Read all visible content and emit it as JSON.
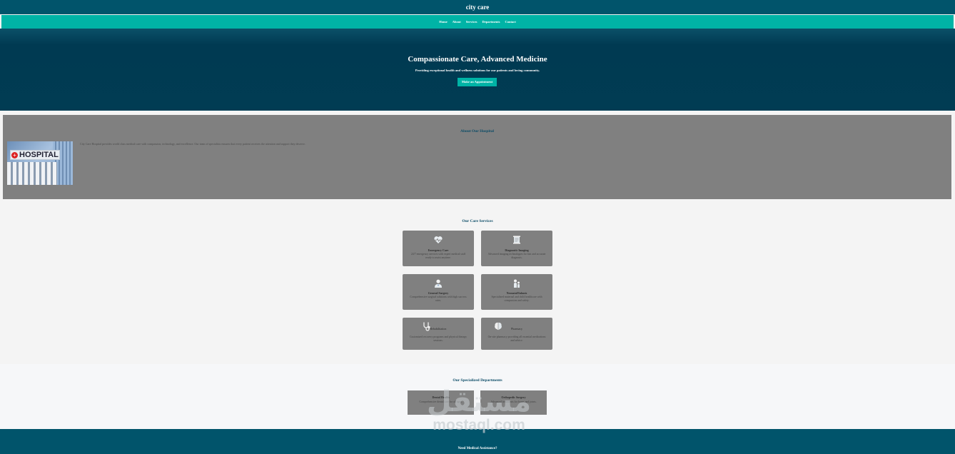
{
  "header": {
    "title": "city care"
  },
  "nav": {
    "items": [
      "Home",
      "About",
      "Services",
      "Departments",
      "Contact"
    ]
  },
  "hero": {
    "title": "Compassionate Care, Advanced Medicine",
    "subtitle": "Providing exceptional health and wellness solutions for our patients and loving community.",
    "cta": "Make an Appointment"
  },
  "about": {
    "heading": "About Our Hospital",
    "text": "City Care Hospital provides world class medical care with compassion, technology, and excellence. Our team of specialists ensures that every patient receives the attention and support they deserve.",
    "image_sign": "HOSPITAL"
  },
  "services": {
    "heading": "Our Care Services",
    "items": [
      {
        "icon": "heart-pulse-icon",
        "title": "Emergency Care",
        "desc": "24/7 emergency services with expert medical staff ready to assist anytime."
      },
      {
        "icon": "scroll-icon",
        "title": "Diagnostic Imaging",
        "desc": "Advanced imaging technologies for fast and accurate diagnosis."
      },
      {
        "icon": "doctor-icon",
        "title": "General Surgery",
        "desc": "Comprehensive surgical solutions with high success rates."
      },
      {
        "icon": "child-care-icon",
        "title": "Neonatal/Infants",
        "desc": "Specialized maternal and child healthcare with compassion and safety."
      },
      {
        "icon": "stethoscope-icon",
        "title": "Rehabilitation",
        "desc": "Customized recovery programs and physical therapy sessions."
      },
      {
        "icon": "brain-icon",
        "title": "Pharmacy",
        "desc": "On-site pharmacy providing all essential medications and advice."
      }
    ]
  },
  "departments": {
    "heading": "Our Specialized Departments",
    "items": [
      {
        "title": "Dental Health",
        "desc": "Comprehensive dental care for all ages."
      },
      {
        "title": "Orthopedic Surgery",
        "desc": "Advanced treatments for bones and joints."
      }
    ]
  },
  "footer": {
    "heading": "Need Medical Assistance?"
  },
  "watermark": {
    "arabic": "مستقل",
    "latin": "mostaql.com"
  }
}
